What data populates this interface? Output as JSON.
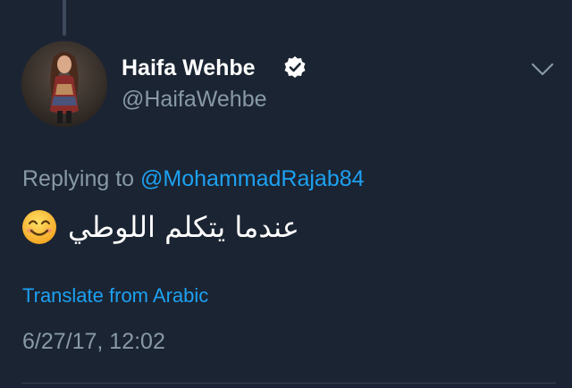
{
  "tweet": {
    "author": {
      "display_name": "Haifa Wehbe",
      "handle": "@HaifaWehbe",
      "verified": true,
      "avatar_icon": "profile-photo"
    },
    "replying_prefix": "Replying to",
    "replying_to": "@MohammadRajab84",
    "text": "عندما يتكلم اللوطي",
    "emoji_icon": "smiling-face-emoji",
    "translate_label": "Translate from Arabic",
    "timestamp": "6/27/17, 12:02"
  },
  "colors": {
    "background": "#1b2432",
    "primary_text": "#ffffff",
    "secondary_text": "#8899a6",
    "link": "#1da1f2"
  }
}
